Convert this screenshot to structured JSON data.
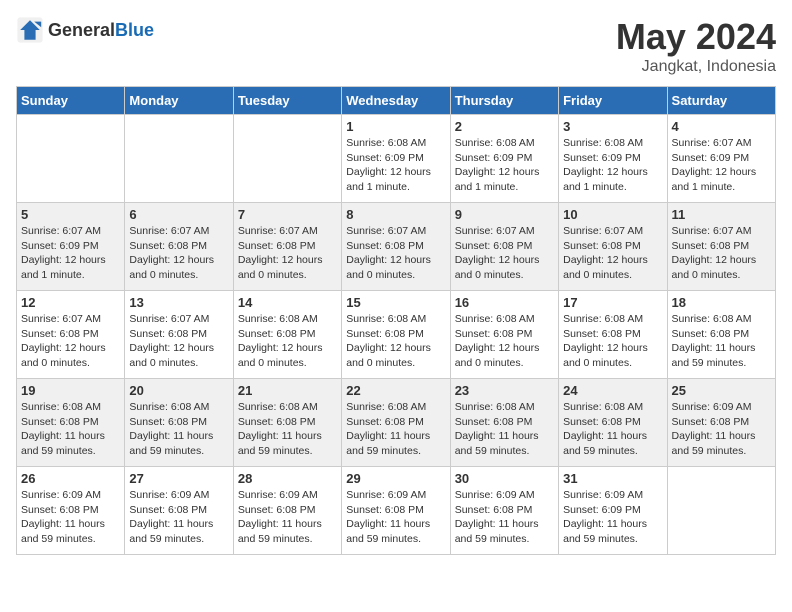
{
  "logo": {
    "general": "General",
    "blue": "Blue"
  },
  "title": "May 2024",
  "subtitle": "Jangkat, Indonesia",
  "days_header": [
    "Sunday",
    "Monday",
    "Tuesday",
    "Wednesday",
    "Thursday",
    "Friday",
    "Saturday"
  ],
  "weeks": [
    [
      {
        "day": "",
        "info": ""
      },
      {
        "day": "",
        "info": ""
      },
      {
        "day": "",
        "info": ""
      },
      {
        "day": "1",
        "info": "Sunrise: 6:08 AM\nSunset: 6:09 PM\nDaylight: 12 hours\nand 1 minute."
      },
      {
        "day": "2",
        "info": "Sunrise: 6:08 AM\nSunset: 6:09 PM\nDaylight: 12 hours\nand 1 minute."
      },
      {
        "day": "3",
        "info": "Sunrise: 6:08 AM\nSunset: 6:09 PM\nDaylight: 12 hours\nand 1 minute."
      },
      {
        "day": "4",
        "info": "Sunrise: 6:07 AM\nSunset: 6:09 PM\nDaylight: 12 hours\nand 1 minute."
      }
    ],
    [
      {
        "day": "5",
        "info": "Sunrise: 6:07 AM\nSunset: 6:09 PM\nDaylight: 12 hours\nand 1 minute."
      },
      {
        "day": "6",
        "info": "Sunrise: 6:07 AM\nSunset: 6:08 PM\nDaylight: 12 hours\nand 0 minutes."
      },
      {
        "day": "7",
        "info": "Sunrise: 6:07 AM\nSunset: 6:08 PM\nDaylight: 12 hours\nand 0 minutes."
      },
      {
        "day": "8",
        "info": "Sunrise: 6:07 AM\nSunset: 6:08 PM\nDaylight: 12 hours\nand 0 minutes."
      },
      {
        "day": "9",
        "info": "Sunrise: 6:07 AM\nSunset: 6:08 PM\nDaylight: 12 hours\nand 0 minutes."
      },
      {
        "day": "10",
        "info": "Sunrise: 6:07 AM\nSunset: 6:08 PM\nDaylight: 12 hours\nand 0 minutes."
      },
      {
        "day": "11",
        "info": "Sunrise: 6:07 AM\nSunset: 6:08 PM\nDaylight: 12 hours\nand 0 minutes."
      }
    ],
    [
      {
        "day": "12",
        "info": "Sunrise: 6:07 AM\nSunset: 6:08 PM\nDaylight: 12 hours\nand 0 minutes."
      },
      {
        "day": "13",
        "info": "Sunrise: 6:07 AM\nSunset: 6:08 PM\nDaylight: 12 hours\nand 0 minutes."
      },
      {
        "day": "14",
        "info": "Sunrise: 6:08 AM\nSunset: 6:08 PM\nDaylight: 12 hours\nand 0 minutes."
      },
      {
        "day": "15",
        "info": "Sunrise: 6:08 AM\nSunset: 6:08 PM\nDaylight: 12 hours\nand 0 minutes."
      },
      {
        "day": "16",
        "info": "Sunrise: 6:08 AM\nSunset: 6:08 PM\nDaylight: 12 hours\nand 0 minutes."
      },
      {
        "day": "17",
        "info": "Sunrise: 6:08 AM\nSunset: 6:08 PM\nDaylight: 12 hours\nand 0 minutes."
      },
      {
        "day": "18",
        "info": "Sunrise: 6:08 AM\nSunset: 6:08 PM\nDaylight: 11 hours\nand 59 minutes."
      }
    ],
    [
      {
        "day": "19",
        "info": "Sunrise: 6:08 AM\nSunset: 6:08 PM\nDaylight: 11 hours\nand 59 minutes."
      },
      {
        "day": "20",
        "info": "Sunrise: 6:08 AM\nSunset: 6:08 PM\nDaylight: 11 hours\nand 59 minutes."
      },
      {
        "day": "21",
        "info": "Sunrise: 6:08 AM\nSunset: 6:08 PM\nDaylight: 11 hours\nand 59 minutes."
      },
      {
        "day": "22",
        "info": "Sunrise: 6:08 AM\nSunset: 6:08 PM\nDaylight: 11 hours\nand 59 minutes."
      },
      {
        "day": "23",
        "info": "Sunrise: 6:08 AM\nSunset: 6:08 PM\nDaylight: 11 hours\nand 59 minutes."
      },
      {
        "day": "24",
        "info": "Sunrise: 6:08 AM\nSunset: 6:08 PM\nDaylight: 11 hours\nand 59 minutes."
      },
      {
        "day": "25",
        "info": "Sunrise: 6:09 AM\nSunset: 6:08 PM\nDaylight: 11 hours\nand 59 minutes."
      }
    ],
    [
      {
        "day": "26",
        "info": "Sunrise: 6:09 AM\nSunset: 6:08 PM\nDaylight: 11 hours\nand 59 minutes."
      },
      {
        "day": "27",
        "info": "Sunrise: 6:09 AM\nSunset: 6:08 PM\nDaylight: 11 hours\nand 59 minutes."
      },
      {
        "day": "28",
        "info": "Sunrise: 6:09 AM\nSunset: 6:08 PM\nDaylight: 11 hours\nand 59 minutes."
      },
      {
        "day": "29",
        "info": "Sunrise: 6:09 AM\nSunset: 6:08 PM\nDaylight: 11 hours\nand 59 minutes."
      },
      {
        "day": "30",
        "info": "Sunrise: 6:09 AM\nSunset: 6:08 PM\nDaylight: 11 hours\nand 59 minutes."
      },
      {
        "day": "31",
        "info": "Sunrise: 6:09 AM\nSunset: 6:09 PM\nDaylight: 11 hours\nand 59 minutes."
      },
      {
        "day": "",
        "info": ""
      }
    ]
  ]
}
